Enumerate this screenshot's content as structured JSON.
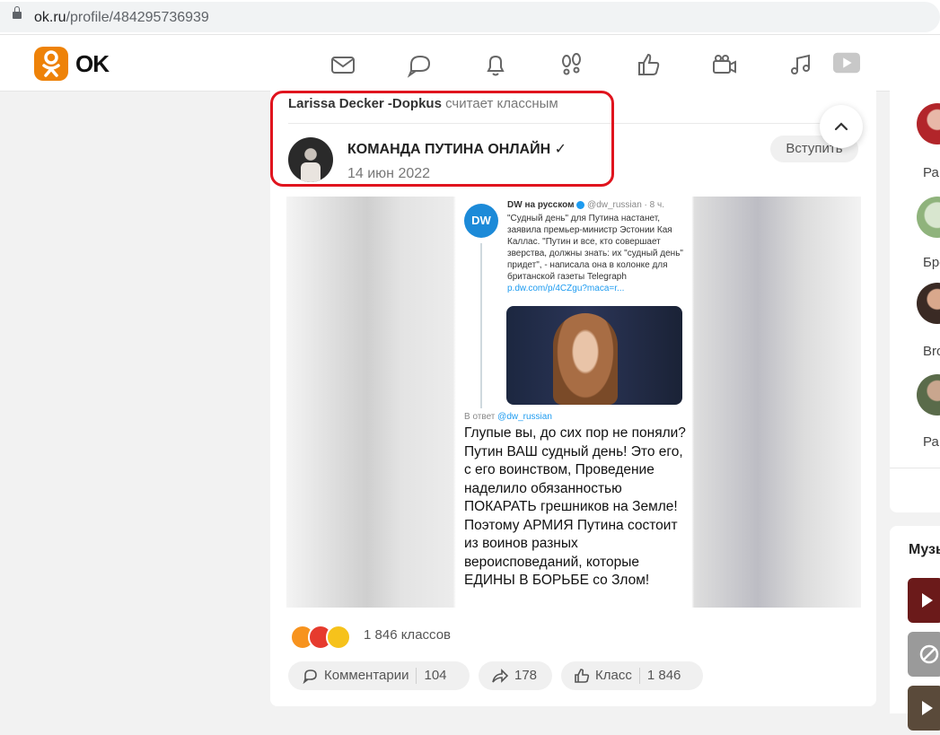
{
  "browser": {
    "url_host": "ok.ru",
    "url_path": "/profile/484295736939"
  },
  "header": {
    "logo_text": "OK",
    "nav_icons": [
      "mail-icon",
      "chat-icon",
      "bell-icon",
      "footprints-icon",
      "thumbs-up-icon",
      "video-camera-icon",
      "music-note-icon",
      "video-play-icon"
    ]
  },
  "post": {
    "liker_name": "Larissa Decker -Dopkus",
    "liker_action": "считает классным",
    "group_name": "КОМАНДА ПУТИНА ОНЛАЙН ✓",
    "date": "14 июн 2022",
    "join_label": "Вступить",
    "tweet": {
      "author": "DW на русском",
      "handle": "@dw_russian · 8 ч.",
      "logo": "DW",
      "text": "\"Судный день\" для Путина настанет, заявила премьер-министр Эстонии Кая Каллас. \"Путин и все, кто совершает зверства, должны знать: их \"судный день\" придет\", - написала она в колонке для британской газеты Telegraph ",
      "link": "p.dw.com/p/4CZgu?maca=r...",
      "reply_prefix": "В ответ ",
      "reply_handle": "@dw_russian",
      "reply_text": "Глупые вы, до сих пор не поняли? Путин ВАШ судный день! Это его, с его воинством, Проведение наделило обязанностью ПОКАРАТЬ грешников на Земле! Поэтому АРМИЯ Путина состоит из воинов разных вероисповеданий, которые ЕДИНЫ В БОРЬБЕ со Злом!"
    },
    "reactions_count": "1 846 классов",
    "comments_label": "Комментарии",
    "comments_count": "104",
    "shares_count": "178",
    "class_label": "Класс",
    "class_count": "1 846"
  },
  "right": {
    "friends": [
      "Ра",
      "Бро",
      "Bro",
      "Ра"
    ],
    "music_title": "Музыка"
  },
  "colors": {
    "brand": "#ee8208",
    "highlight": "#e0141e",
    "link": "#1d9bf0"
  }
}
